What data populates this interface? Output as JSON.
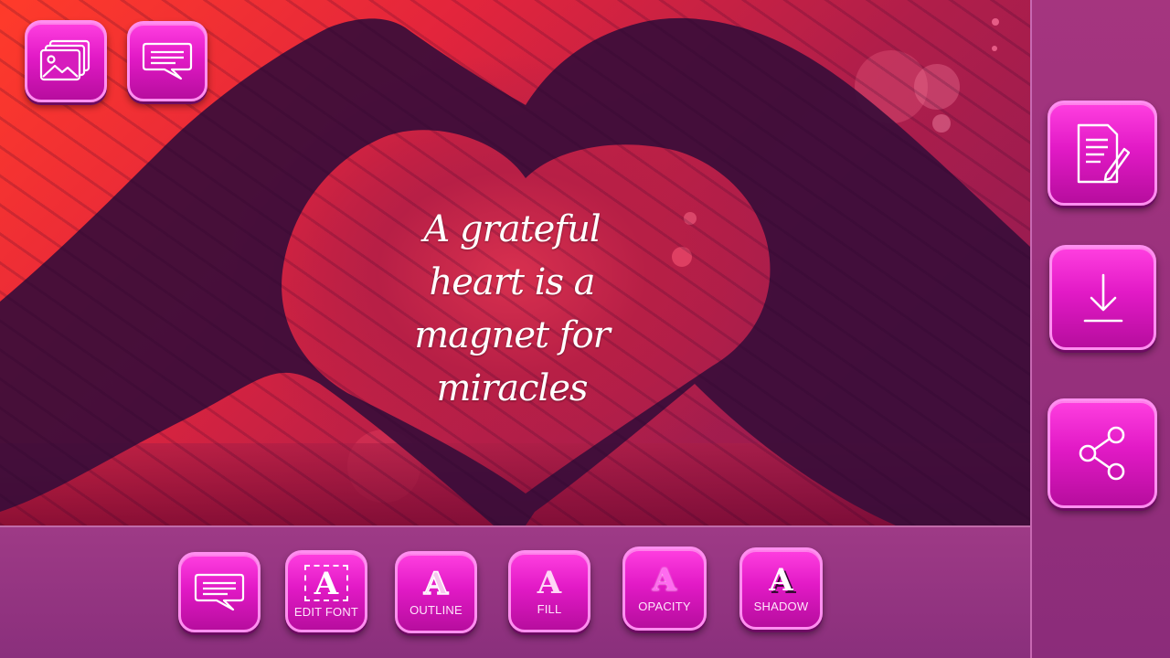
{
  "quote": {
    "text": "A grateful\nheart is a\nmagnet for\nmiracles"
  },
  "top_buttons": [
    {
      "icon": "gallery-icon"
    },
    {
      "icon": "speech-bubble-icon"
    }
  ],
  "sidebar": {
    "buttons": [
      {
        "icon": "edit-document-icon"
      },
      {
        "icon": "download-icon"
      },
      {
        "icon": "share-icon"
      }
    ]
  },
  "toolbar": {
    "buttons": [
      {
        "icon": "speech-bubble-icon",
        "label": ""
      },
      {
        "icon": "font-glyph-icon",
        "glyph": "A",
        "label": "EDIT FONT"
      },
      {
        "icon": "font-glyph-icon",
        "glyph": "A",
        "label": "OUTLINE"
      },
      {
        "icon": "font-glyph-icon",
        "glyph": "A",
        "label": "FILL"
      },
      {
        "icon": "font-glyph-icon",
        "glyph": "A",
        "label": "OPACITY"
      },
      {
        "icon": "font-glyph-icon",
        "glyph": "A",
        "label": "SHADOW"
      }
    ]
  },
  "colors": {
    "accent": "#e21ac6",
    "panel": "#9e3a86",
    "canvas_red": "#e3253c",
    "hands": "#3a0d3a"
  }
}
